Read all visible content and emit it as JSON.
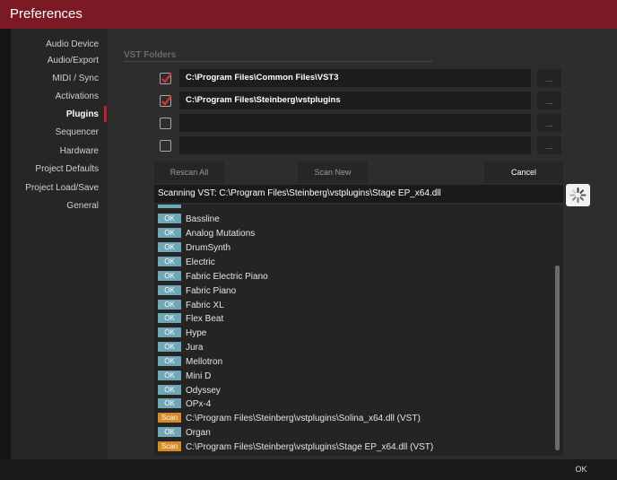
{
  "window": {
    "title": "Preferences"
  },
  "sidebar": {
    "items": [
      {
        "label": "Audio Device",
        "active": false
      },
      {
        "label": "Audio/Export",
        "active": false
      },
      {
        "label": "MIDI / Sync",
        "active": false
      },
      {
        "label": "Activations",
        "active": false
      },
      {
        "label": "Plugins",
        "active": true
      },
      {
        "label": "Sequencer",
        "active": false
      },
      {
        "label": "Hardware",
        "active": false
      },
      {
        "label": "Project Defaults",
        "active": false
      },
      {
        "label": "Project Load/Save",
        "active": false
      },
      {
        "label": "General",
        "active": false
      }
    ]
  },
  "vst_folders": {
    "title": "VST Folders",
    "folders": [
      {
        "path": "C:\\Program Files\\Common Files\\VST3",
        "checked": true,
        "browse_label": "..."
      },
      {
        "path": "C:\\Program Files\\Steinberg\\vstplugins",
        "checked": true,
        "browse_label": "..."
      },
      {
        "path": "",
        "checked": false,
        "browse_label": "..."
      },
      {
        "path": "",
        "checked": false,
        "browse_label": "..."
      }
    ]
  },
  "actions": {
    "rescan_all": "Rescan All",
    "scan_new": "Scan New",
    "cancel": "Cancel"
  },
  "scan": {
    "status": "Scanning VST: C:\\Program Files\\Steinberg\\vstplugins\\Stage EP_x64.dll",
    "spinner_icon": "loading-spinner-icon"
  },
  "results": [
    {
      "badge": "OK",
      "name": "Bassline"
    },
    {
      "badge": "OK",
      "name": "Analog Mutations"
    },
    {
      "badge": "OK",
      "name": "DrumSynth"
    },
    {
      "badge": "OK",
      "name": "Electric"
    },
    {
      "badge": "OK",
      "name": "Fabric Electric Piano"
    },
    {
      "badge": "OK",
      "name": "Fabric Piano"
    },
    {
      "badge": "OK",
      "name": "Fabric XL"
    },
    {
      "badge": "OK",
      "name": "Flex Beat"
    },
    {
      "badge": "OK",
      "name": "Hype"
    },
    {
      "badge": "OK",
      "name": "Jura"
    },
    {
      "badge": "OK",
      "name": "Mellotron"
    },
    {
      "badge": "OK",
      "name": "Mini D"
    },
    {
      "badge": "OK",
      "name": "Odyssey"
    },
    {
      "badge": "OK",
      "name": "OPx-4"
    },
    {
      "badge": "Scan",
      "name": "C:\\Program Files\\Steinberg\\vstplugins\\Solina_x64.dll (VST)"
    },
    {
      "badge": "OK",
      "name": "Organ"
    },
    {
      "badge": "Scan",
      "name": "C:\\Program Files\\Steinberg\\vstplugins\\Stage EP_x64.dll (VST)"
    }
  ],
  "footer": {
    "ok_label": "OK"
  },
  "colors": {
    "title_bar": "#7b1a25",
    "accent": "#c01f2d",
    "ok_badge": "#6fa7b4",
    "scan_badge": "#d68a20"
  }
}
